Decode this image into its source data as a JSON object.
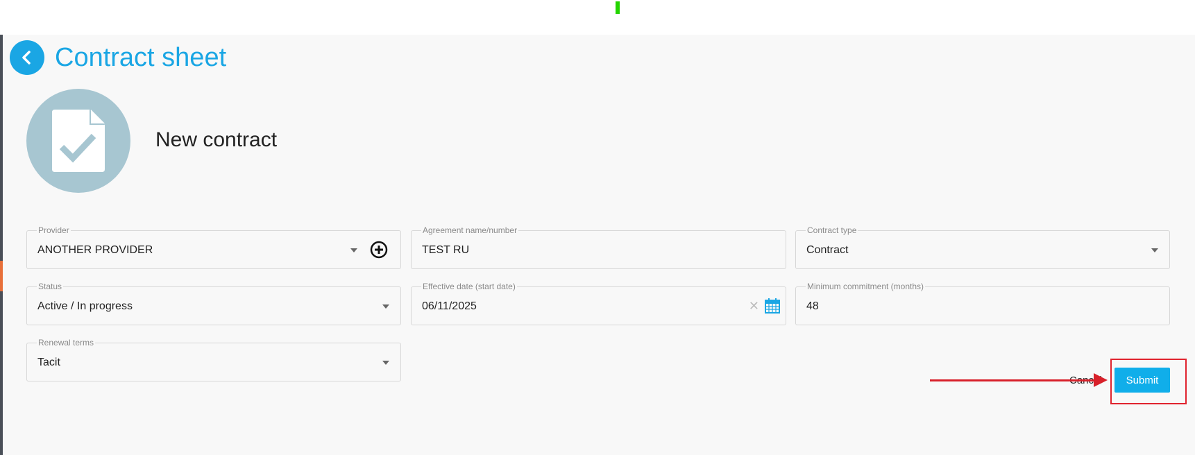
{
  "page": {
    "title": "Contract sheet",
    "entity_name": "New contract"
  },
  "fields": {
    "provider": {
      "label": "Provider",
      "value": "ANOTHER PROVIDER"
    },
    "agreement": {
      "label": "Agreement name/number",
      "value": "TEST RU"
    },
    "contract_type": {
      "label": "Contract type",
      "value": "Contract"
    },
    "status": {
      "label": "Status",
      "value": "Active / In progress"
    },
    "effective_date": {
      "label": "Effective date (start date)",
      "value": "06/11/2025"
    },
    "min_commitment": {
      "label": "Minimum commitment (months)",
      "value": "48"
    },
    "renewal_terms": {
      "label": "Renewal terms",
      "value": "Tacit"
    }
  },
  "actions": {
    "cancel_label": "Cancel",
    "submit_label": "Submit",
    "clear_symbol": "✕"
  },
  "colors": {
    "accent": "#1aa6e4",
    "avatar_bg": "#a7c6d1",
    "annotation_red": "#e0232e"
  },
  "icons": {
    "back": "chevron-left-icon",
    "avatar": "document-check-icon",
    "add_provider": "plus-circle-icon",
    "clear": "close-icon",
    "calendar": "calendar-icon",
    "dropdown": "caret-down-icon"
  }
}
